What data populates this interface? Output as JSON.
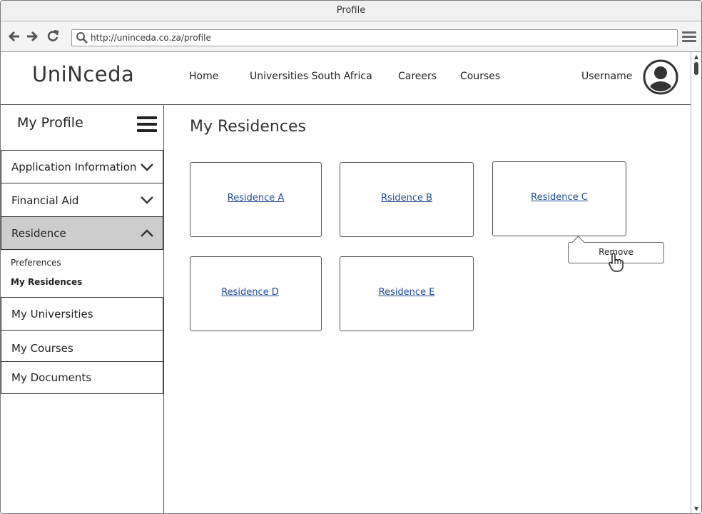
{
  "window": {
    "title": "Profile"
  },
  "browser": {
    "url": "http://uninceda.co.za/profile",
    "icons": [
      "back-arrow-icon",
      "forward-arrow-icon",
      "reload-icon",
      "search-icon",
      "hamburger-menu-icon"
    ]
  },
  "header": {
    "logo": "UniNceda",
    "nav": [
      "Home",
      "Universities South Africa",
      "Careers",
      "Courses"
    ],
    "username": "Username",
    "avatar_icon": "user-avatar-icon"
  },
  "sidebar": {
    "title": "My Profile",
    "sections": [
      {
        "label": "Application Information",
        "expanded": false
      },
      {
        "label": "Financial Aid",
        "expanded": false
      },
      {
        "label": "Residence",
        "expanded": true,
        "children": [
          {
            "label": "Preferences",
            "selected": false
          },
          {
            "label": "My Residences",
            "selected": true
          }
        ]
      }
    ],
    "links": [
      "My Universities",
      "My Courses",
      "My Documents"
    ]
  },
  "main": {
    "title": "My Residences",
    "cards": [
      "Residence A",
      "Rsidence B",
      "Residence C",
      "Residence D",
      "Residence E"
    ],
    "context_menu": {
      "label": "Remove"
    }
  },
  "colors": {
    "link": "#1e4b8f",
    "active_section": "#cdcdcd",
    "border": "#555555"
  }
}
